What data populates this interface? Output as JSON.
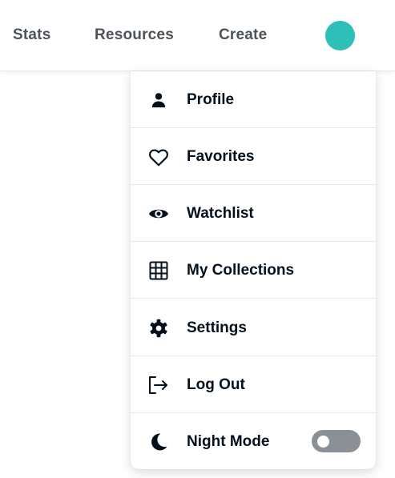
{
  "topnav": {
    "links": [
      "Stats",
      "Resources",
      "Create"
    ],
    "avatar_color": "#2ebfb8"
  },
  "menu": {
    "items": [
      {
        "label": "Profile",
        "icon": "person-icon"
      },
      {
        "label": "Favorites",
        "icon": "heart-icon"
      },
      {
        "label": "Watchlist",
        "icon": "eye-icon"
      },
      {
        "label": "My Collections",
        "icon": "grid-icon"
      },
      {
        "label": "Settings",
        "icon": "gear-icon"
      },
      {
        "label": "Log Out",
        "icon": "logout-icon"
      },
      {
        "label": "Night Mode",
        "icon": "moon-icon"
      }
    ],
    "night_mode": {
      "on": false,
      "track_color": "#8a9095"
    }
  }
}
